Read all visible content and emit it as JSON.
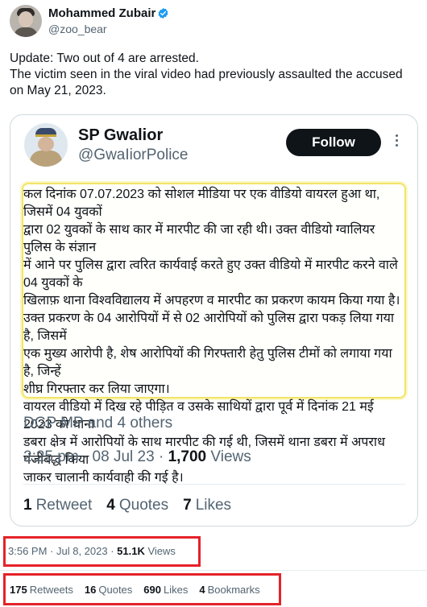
{
  "author": {
    "name": "Mohammed Zubair",
    "handle": "@zoo_bear"
  },
  "tweet": {
    "lines": [
      "Update: Two out of 4 are arrested.",
      "The victim seen in the viral video had previously assaulted the accused",
      "on May 21, 2023."
    ]
  },
  "quoted": {
    "name": "SP Gwalior",
    "handle": "@GwaIiorPolice",
    "follow_label": "Follow",
    "notice": {
      "para1": [
        "कल दिनांक 07.07.2023 को सोशल मीडिया पर एक वीडियो वायरल हुआ था, जिसमें 04 युवकों",
        "द्वारा 02 युवकों के साथ कार में मारपीट की जा रही थी। उक्त वीडियो ग्वालियर पुलिस के संज्ञान",
        "में आने पर पुलिस द्वारा त्वरित कार्यवाई करते हुए उक्त वीडियो में मारपीट करने वाले 04 युवकों के",
        "खिलाफ़ थाना विश्वविद्यालय में अपहरण व मारपीट का प्रकरण कायम किया गया है।"
      ],
      "para2": [
        "उक्त प्रकरण के 04 आरोपियों में से 02 आरोपियों को पुलिस द्वारा पकड़ लिया गया है, जिसमें",
        "एक मुख्य आरोपी है, शेष आरोपियों की गिरफ्तारी हेतु पुलिस टीमों को लगाया गया है, जिन्हें",
        "शीघ्र गिरफ्तार कर लिया जाएगा।"
      ],
      "para3": [
        "वायरल वीडियो में दिख रहे पीड़ित व उसके साथियों द्वारा पूर्व में दिनांक 21 मई 2023 को थाना",
        "डबरा क्षेत्र में आरोपियों के साथ मारपीट की गई थी, जिसमें थाना डबरा में अपराध पंजीबद्ध किया",
        "जाकर चालानी कार्यवाही की गई है।"
      ]
    },
    "liked_by": "DGP MP and 4 others",
    "time": "2:25 pm",
    "date": "08 Jul 23",
    "views_count": "1,700",
    "views_label": "Views",
    "retweets_count": "1",
    "retweets_label": "Retweet",
    "quotes_count": "4",
    "quotes_label": "Quotes",
    "likes_count": "7",
    "likes_label": "Likes"
  },
  "meta": {
    "time": "3:56 PM",
    "date": "Jul 8, 2023",
    "views_count": "51.1K",
    "views_label": "Views"
  },
  "stats": {
    "retweets_count": "175",
    "retweets_label": "Retweets",
    "quotes_count": "16",
    "quotes_label": "Quotes",
    "likes_count": "690",
    "likes_label": "Likes",
    "bookmarks_count": "4",
    "bookmarks_label": "Bookmarks"
  },
  "colors": {
    "highlight_box": "#e52229",
    "verified": "#1d9bf0",
    "notice_border": "#f2e46a",
    "notice_text": "#1b2a6b"
  }
}
